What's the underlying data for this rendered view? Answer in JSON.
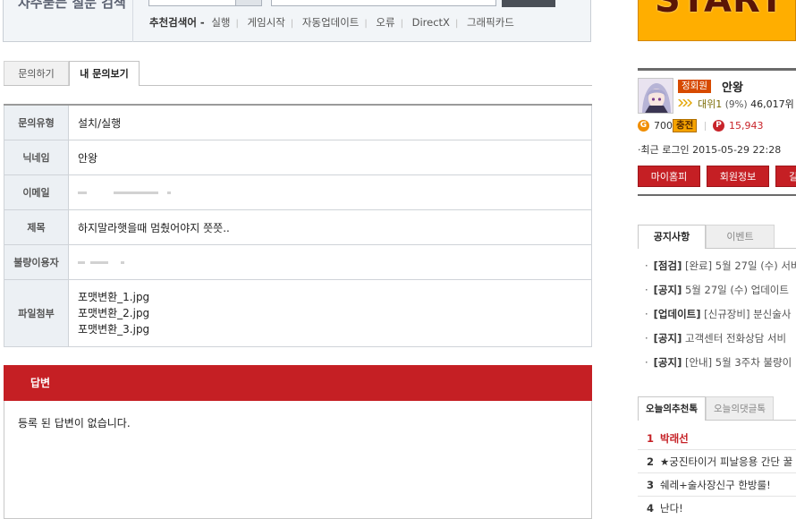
{
  "faq": {
    "title": "자주묻는 질문 검색",
    "recommend_label": "추천검색어 -",
    "keywords": [
      "실행",
      "게임시작",
      "자동업데이트",
      "오류",
      "DirectX",
      "그래픽카드"
    ]
  },
  "tabs": {
    "ask": "문의하기",
    "my": "내 문의보기"
  },
  "inquiry": {
    "type_label": "문의유형",
    "type_value": "설치/실행",
    "nick_label": "닉네임",
    "nick_value": "안왕",
    "email_label": "이메일",
    "subject_label": "제목",
    "subject_value": "하지말라햇을때 멈췄어야지 쯧쯧..",
    "baduser_label": "불량이용자",
    "files_label": "파일첨부",
    "files": [
      "포맷변환_1.jpg",
      "포맷변환_2.jpg",
      "포맷변환_3.jpg"
    ]
  },
  "answer": {
    "header": "답변",
    "body": "등록 된 답변이 없습니다."
  },
  "banner": {
    "text": "START"
  },
  "profile": {
    "grade": "정회원",
    "name": "안왕",
    "rank_level": "대위1",
    "rank_pct": "(9%)",
    "rank_pos": "46,017위",
    "g_icon": "G",
    "g_value": "700",
    "charge": "충전",
    "p_icon": "P",
    "p_value": "15,943",
    "last_login": "최근 로그인 2015-05-29 22:28",
    "buttons": [
      "마이홈피",
      "회원정보",
      "길"
    ]
  },
  "notice_tabs": {
    "notice": "공지사항",
    "event": "이벤트"
  },
  "notices": [
    {
      "tag": "[점검]",
      "text": "[완료] 5월 27일 (수) 서버"
    },
    {
      "tag": "[공지]",
      "text": "5월 27일 (수) 업데이트"
    },
    {
      "tag": "[업데이트]",
      "text": "[신규장비] 분신술사"
    },
    {
      "tag": "[공지]",
      "text": "고객센터 전화상담 서비"
    },
    {
      "tag": "[공지]",
      "text": "[안내] 5월 3주차 불량이"
    }
  ],
  "rec_tabs": {
    "today_rec": "오늘의추천톡",
    "today_reply": "오늘의댓글톡"
  },
  "recs": [
    {
      "n": "1",
      "text": "박래선"
    },
    {
      "n": "2",
      "text": "★궁진타이거 피날응용 간단 꿀"
    },
    {
      "n": "3",
      "text": "쉐레+술사장신구 한방룰!"
    },
    {
      "n": "4",
      "text": "난다!"
    }
  ],
  "colors": {
    "accent_red": "#c51f24",
    "header_bg": "#ecf0f4",
    "banner": "#ffae00"
  }
}
